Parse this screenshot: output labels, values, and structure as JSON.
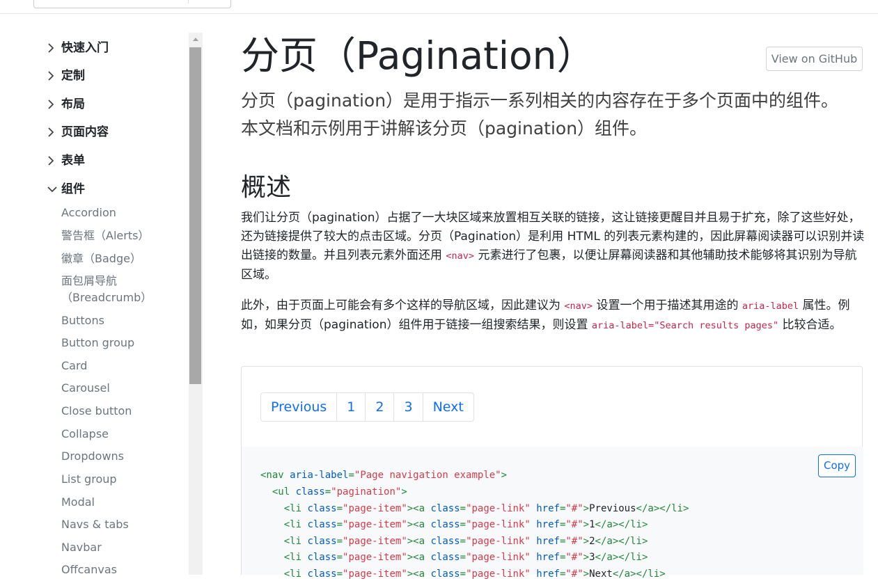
{
  "sidebar": {
    "sections": [
      {
        "label": "快速入门",
        "expanded": false
      },
      {
        "label": "定制",
        "expanded": false
      },
      {
        "label": "布局",
        "expanded": false
      },
      {
        "label": "页面内容",
        "expanded": false
      },
      {
        "label": "表单",
        "expanded": false
      },
      {
        "label": "组件",
        "expanded": true
      }
    ],
    "component_items": [
      "Accordion",
      "警告框（Alerts）",
      "徽章（Badge）",
      "面包屑导航",
      "（Breadcrumb）",
      "Buttons",
      "Button group",
      "Card",
      "Carousel",
      "Close button",
      "Collapse",
      "Dropdowns",
      "List group",
      "Modal",
      "Navs & tabs",
      "Navbar",
      "Offcanvas"
    ]
  },
  "page": {
    "title": "分页（Pagination）",
    "github_button": "View on GitHub",
    "lead": "分页（pagination）是用于指示一系列相关的内容存在于多个页面中的组件。本文档和示例用于讲解该分页（pagination）组件。",
    "overview_heading": "概述",
    "para1": {
      "before": "我们让分页（pagination）占据了一大块区域来放置相互关联的链接，这让链接更醒目并且易于扩充，除了这些好处，还为链接提供了较大的点击区域。分页（Pagination）是利用 HTML 的列表元素构建的，因此屏幕阅读器可以识别并读出链接的数量。并且列表元素外面还用 ",
      "code": "<nav>",
      "after": " 元素进行了包裹，以便让屏幕阅读器和其他辅助技术能够将其识别为导航区域。"
    },
    "para2": {
      "part1": "此外，由于页面上可能会有多个这样的导航区域，因此建议为 ",
      "code1": "<nav>",
      "part2": " 设置一个用于描述其用途的 ",
      "code2": "aria-label",
      "part3": " 属性。例如，如果分页（pagination）组件用于链接一组搜索结果，则设置 ",
      "code3": "aria-label=\"Search results pages\"",
      "part4": " 比较合适。"
    }
  },
  "example": {
    "pagination": [
      "Previous",
      "1",
      "2",
      "3",
      "Next"
    ]
  },
  "code": {
    "copy_label": "Copy",
    "lines": [
      [
        [
          "tag",
          "<nav "
        ],
        [
          "attr",
          "aria-label"
        ],
        [
          "tag",
          "="
        ],
        [
          "str",
          "\"Page navigation example\""
        ],
        [
          "tag",
          ">"
        ]
      ],
      [
        [
          "tag",
          "  <ul "
        ],
        [
          "attr",
          "class"
        ],
        [
          "tag",
          "="
        ],
        [
          "str",
          "\"pagination\""
        ],
        [
          "tag",
          ">"
        ]
      ],
      [
        [
          "tag",
          "    <li "
        ],
        [
          "attr",
          "class"
        ],
        [
          "tag",
          "="
        ],
        [
          "str",
          "\"page-item\""
        ],
        [
          "tag",
          "><a "
        ],
        [
          "attr",
          "class"
        ],
        [
          "tag",
          "="
        ],
        [
          "str",
          "\"page-link\""
        ],
        [
          "tag",
          " "
        ],
        [
          "attr",
          "href"
        ],
        [
          "tag",
          "="
        ],
        [
          "str",
          "\"#\""
        ],
        [
          "tag",
          ">"
        ],
        [
          "txt",
          "Previous"
        ],
        [
          "tag",
          "</a></li>"
        ]
      ],
      [
        [
          "tag",
          "    <li "
        ],
        [
          "attr",
          "class"
        ],
        [
          "tag",
          "="
        ],
        [
          "str",
          "\"page-item\""
        ],
        [
          "tag",
          "><a "
        ],
        [
          "attr",
          "class"
        ],
        [
          "tag",
          "="
        ],
        [
          "str",
          "\"page-link\""
        ],
        [
          "tag",
          " "
        ],
        [
          "attr",
          "href"
        ],
        [
          "tag",
          "="
        ],
        [
          "str",
          "\"#\""
        ],
        [
          "tag",
          ">"
        ],
        [
          "txt",
          "1"
        ],
        [
          "tag",
          "</a></li>"
        ]
      ],
      [
        [
          "tag",
          "    <li "
        ],
        [
          "attr",
          "class"
        ],
        [
          "tag",
          "="
        ],
        [
          "str",
          "\"page-item\""
        ],
        [
          "tag",
          "><a "
        ],
        [
          "attr",
          "class"
        ],
        [
          "tag",
          "="
        ],
        [
          "str",
          "\"page-link\""
        ],
        [
          "tag",
          " "
        ],
        [
          "attr",
          "href"
        ],
        [
          "tag",
          "="
        ],
        [
          "str",
          "\"#\""
        ],
        [
          "tag",
          ">"
        ],
        [
          "txt",
          "2"
        ],
        [
          "tag",
          "</a></li>"
        ]
      ],
      [
        [
          "tag",
          "    <li "
        ],
        [
          "attr",
          "class"
        ],
        [
          "tag",
          "="
        ],
        [
          "str",
          "\"page-item\""
        ],
        [
          "tag",
          "><a "
        ],
        [
          "attr",
          "class"
        ],
        [
          "tag",
          "="
        ],
        [
          "str",
          "\"page-link\""
        ],
        [
          "tag",
          " "
        ],
        [
          "attr",
          "href"
        ],
        [
          "tag",
          "="
        ],
        [
          "str",
          "\"#\""
        ],
        [
          "tag",
          ">"
        ],
        [
          "txt",
          "3"
        ],
        [
          "tag",
          "</a></li>"
        ]
      ],
      [
        [
          "tag",
          "    <li "
        ],
        [
          "attr",
          "class"
        ],
        [
          "tag",
          "="
        ],
        [
          "str",
          "\"page-item\""
        ],
        [
          "tag",
          "><a "
        ],
        [
          "attr",
          "class"
        ],
        [
          "tag",
          "="
        ],
        [
          "str",
          "\"page-link\""
        ],
        [
          "tag",
          " "
        ],
        [
          "attr",
          "href"
        ],
        [
          "tag",
          "="
        ],
        [
          "str",
          "\"#\""
        ],
        [
          "tag",
          ">"
        ],
        [
          "txt",
          "Next"
        ],
        [
          "tag",
          "</a></li>"
        ]
      ]
    ]
  }
}
